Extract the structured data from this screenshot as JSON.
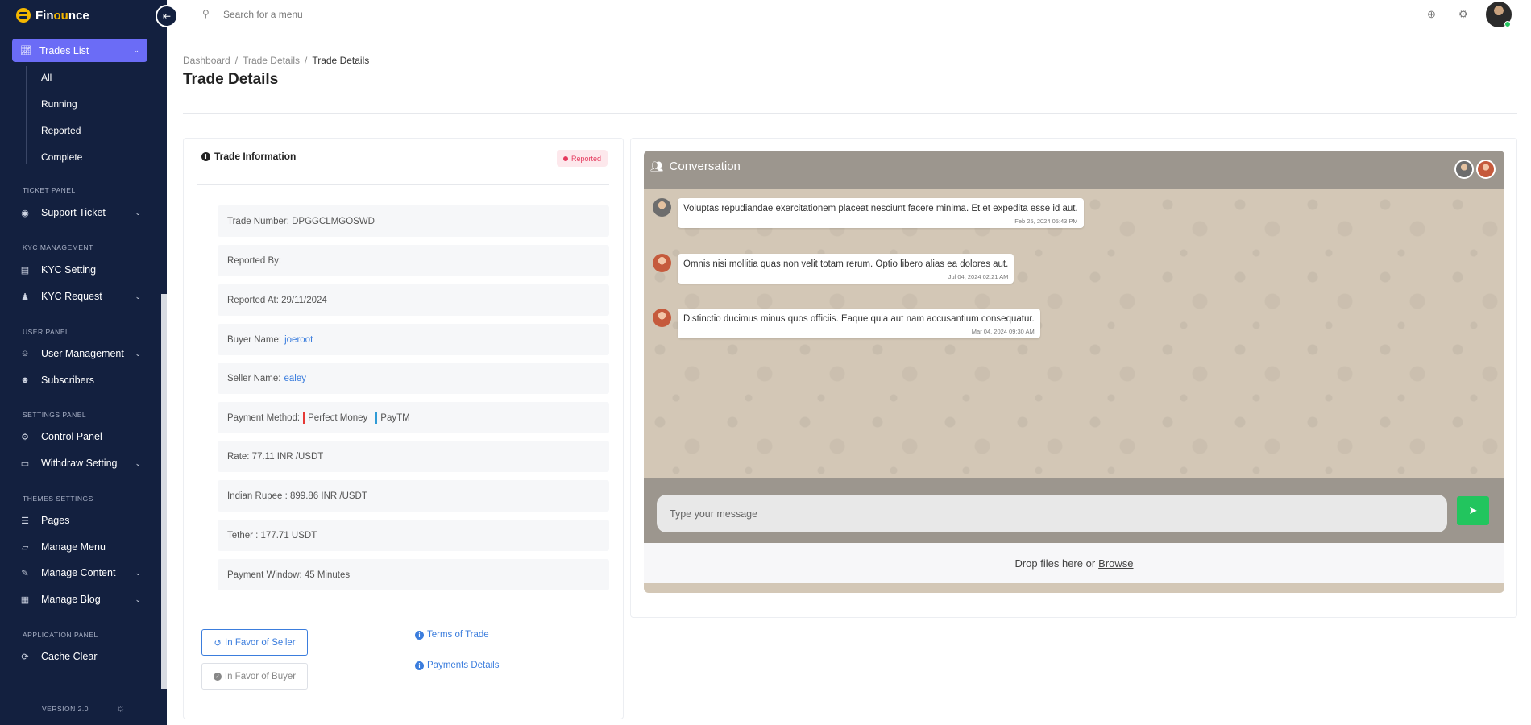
{
  "brand": {
    "name_start": "Fin",
    "name_accent": "ou",
    "name_end": "nce"
  },
  "sidebar": {
    "active": {
      "label": "Trades List"
    },
    "sub_items": [
      "All",
      "Running",
      "Reported",
      "Complete"
    ],
    "sections": {
      "ticket": "TICKET PANEL",
      "kyc": "KYC MANAGEMENT",
      "user": "USER PANEL",
      "settings": "SETTINGS PANEL",
      "themes": "THEMES SETTINGS",
      "application": "APPLICATION PANEL"
    },
    "items": {
      "support_ticket": "Support Ticket",
      "kyc_setting": "KYC Setting",
      "kyc_request": "KYC Request",
      "user_management": "User Management",
      "subscribers": "Subscribers",
      "control_panel": "Control Panel",
      "withdraw_setting": "Withdraw Setting",
      "pages": "Pages",
      "manage_menu": "Manage Menu",
      "manage_content": "Manage Content",
      "manage_blog": "Manage Blog",
      "cache_clear": "Cache Clear"
    },
    "version": "VERSION 2.0"
  },
  "topbar": {
    "search_placeholder": "Search for a menu"
  },
  "breadcrumb": {
    "items": [
      "Dashboard",
      "Trade Details",
      "Trade Details"
    ]
  },
  "page_title": "Trade Details",
  "trade_info": {
    "title": "Trade Information",
    "status": "Reported",
    "trade_number": "Trade Number: DPGGCLMGOSWD",
    "reported_by": "Reported By:",
    "reported_at": "Reported At: 29/11/2024",
    "buyer_label": "Buyer Name:",
    "buyer_name": "joeroot",
    "seller_label": "Seller Name:",
    "seller_name": "ealey",
    "payment_label": "Payment Method:",
    "payment_methods": [
      "Perfect Money",
      "PayTM"
    ],
    "payment_colors": [
      "#e53935",
      "#2f9bd6"
    ],
    "rate": "Rate: 77.11 INR /USDT",
    "indian_rupee": "Indian Rupee : 899.86 INR /USDT",
    "tether": "Tether : 177.71 USDT",
    "payment_window": "Payment Window: 45 Minutes",
    "btn_seller": "In Favor of Seller",
    "btn_buyer": "In Favor of Buyer",
    "link_terms": "Terms of Trade",
    "link_payments": "Payments Details"
  },
  "conversation": {
    "title": "Conversation",
    "messages": [
      {
        "text": "Voluptas repudiandae exercitationem placeat nesciunt facere minima. Et et expedita esse id aut.",
        "time": "Feb 25, 2024 05:43 PM"
      },
      {
        "text": "Omnis nisi mollitia quas non velit totam rerum. Optio libero alias ea dolores aut.",
        "time": "Jul 04, 2024 02:21 AM"
      },
      {
        "text": "Distinctio ducimus minus quos officiis. Eaque quia aut nam accusantium consequatur.",
        "time": "Mar 04, 2024 09:30 AM"
      }
    ],
    "input_placeholder": "Type your message",
    "drop_text": "Drop files here or",
    "browse": "Browse"
  }
}
